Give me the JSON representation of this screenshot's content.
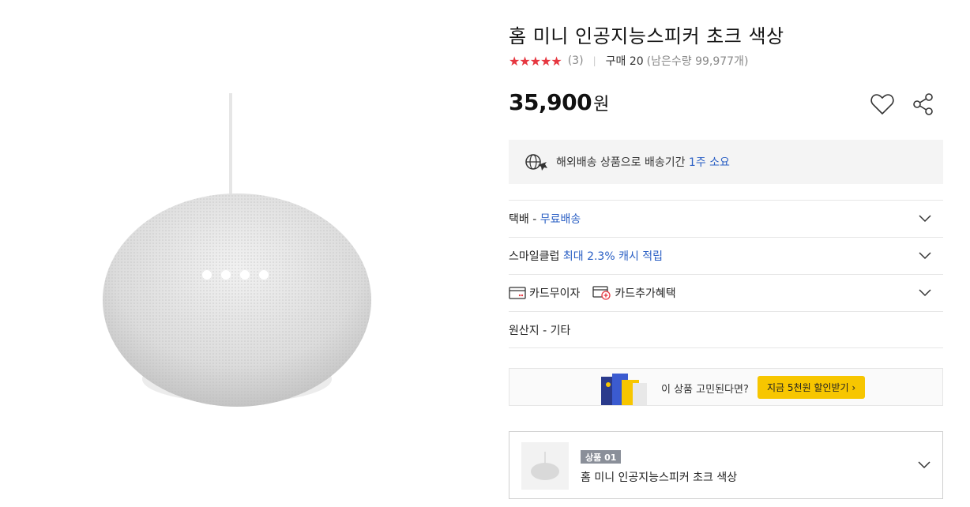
{
  "product": {
    "title": "홈 미니 인공지능스피커 초크 색상",
    "stars": "★★★★★",
    "review_count": "(3)",
    "rating_separator": "|",
    "purchase_count": "구매 20",
    "stock": "(남은수량 99,977개)",
    "price": "35,900",
    "price_unit": "원"
  },
  "shipping": {
    "text": "해외배송 상품으로 배송기간 ",
    "period": "1주 소요"
  },
  "rows": {
    "delivery_label": "택배 - ",
    "delivery_value": "무료배송",
    "smile_label": "스마일클럽 ",
    "smile_value": "최대 2.3% 캐시 적립",
    "card_installment": "카드무이자",
    "card_benefit": "카드추가혜택",
    "origin": "원산지 - 기타"
  },
  "promo": {
    "text": "이 상품 고민된다면?",
    "button": "지금 5천원 할인받기 ›"
  },
  "option": {
    "badge": "상품 01",
    "name": "홈 미니 인공지능스피커 초크 색상"
  },
  "colors": {
    "star": "#e63740",
    "link_blue": "#2a5fc4",
    "promo_yellow": "#f7c600"
  }
}
